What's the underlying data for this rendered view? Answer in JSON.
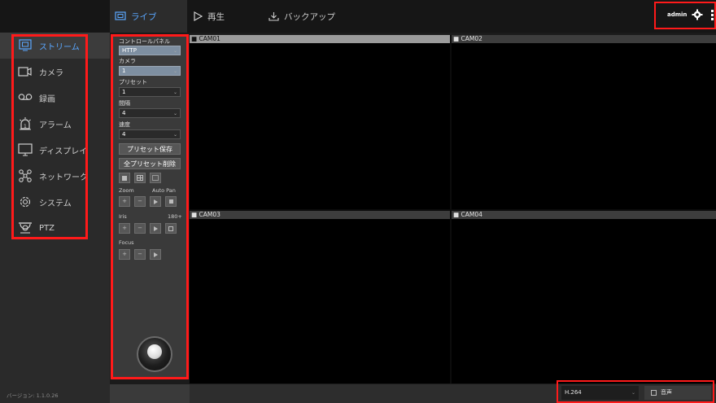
{
  "top": {
    "tabs": [
      {
        "label": "ライブ",
        "icon": "live-icon",
        "active": true
      },
      {
        "label": "再生",
        "icon": "play-icon",
        "active": false
      },
      {
        "label": "バックアップ",
        "icon": "download-icon",
        "active": false
      }
    ],
    "user": "admin",
    "settings_icon": "gear-icon"
  },
  "sidebar": {
    "items": [
      {
        "label": "ストリーム",
        "icon": "stream-icon",
        "active": true
      },
      {
        "label": "カメラ",
        "icon": "camera-icon"
      },
      {
        "label": "録画",
        "icon": "record-icon"
      },
      {
        "label": "アラーム",
        "icon": "alarm-icon"
      },
      {
        "label": "ディスプレイ",
        "icon": "display-icon"
      },
      {
        "label": "ネットワーク",
        "icon": "network-icon"
      },
      {
        "label": "システム",
        "icon": "system-gear-icon"
      },
      {
        "label": "PTZ",
        "icon": "ptz-icon"
      }
    ],
    "version": "バージョン: 1.1.0.26"
  },
  "panel": {
    "control_label": "コントロールパネル",
    "control_value": "HTTP",
    "camera_label": "カメラ",
    "camera_value": "1",
    "preset_label": "プリセット",
    "preset_value": "1",
    "interval_label": "間隔",
    "interval_value": "4",
    "speed_label": "速度",
    "speed_value": "4",
    "save_preset": "プリセット保存",
    "delete_all": "全プリセット削除",
    "zoom": "Zoom",
    "auto_pan": "Auto Pan",
    "iris": "Iris",
    "iris_right": "180+",
    "focus": "Focus"
  },
  "cameras": [
    "CAM01",
    "CAM02",
    "CAM03",
    "CAM04"
  ],
  "status": {
    "codec": "H.264",
    "audio_label": "音声"
  },
  "colors": {
    "accent": "#5aa7ff",
    "highlight": "#ff1a1a"
  }
}
